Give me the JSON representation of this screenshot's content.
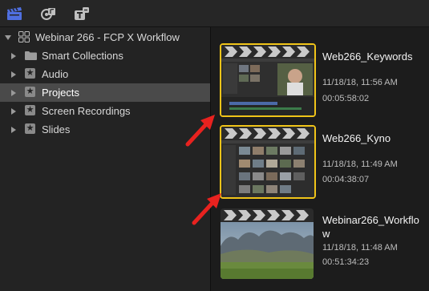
{
  "toolbar": {
    "buttons": [
      {
        "icon": "libraries-clapper-icon",
        "active": true
      },
      {
        "icon": "photos-audio-icon",
        "active": false
      },
      {
        "icon": "titles-generators-icon",
        "active": false
      }
    ]
  },
  "sidebar": {
    "library": {
      "label": "Webinar 266 - FCP X Workflow",
      "expanded": true
    },
    "items": [
      {
        "label": "Smart Collections",
        "icon": "folder-icon",
        "selected": false
      },
      {
        "label": "Audio",
        "icon": "star-event-icon",
        "selected": false
      },
      {
        "label": "Projects",
        "icon": "star-event-icon",
        "selected": true
      },
      {
        "label": "Screen Recordings",
        "icon": "star-event-icon",
        "selected": false
      },
      {
        "label": "Slides",
        "icon": "star-event-icon",
        "selected": false
      }
    ]
  },
  "browser": {
    "projects": [
      {
        "title": "Web266_Keywords",
        "date": "11/18/18, 11:56 AM",
        "duration": "00:05:58:02",
        "selected": true
      },
      {
        "title": "Web266_Kyno",
        "date": "11/18/18, 11:49 AM",
        "duration": "00:04:38:07",
        "selected": true
      },
      {
        "title": "Webinar266_Workflow",
        "date": "11/18/18, 11:48 AM",
        "duration": "00:51:34:23",
        "selected": false
      }
    ]
  },
  "colors": {
    "selection": "#f0c419",
    "annotation_arrow": "#e8221f",
    "sidebar_selected": "#4a4a4a"
  }
}
